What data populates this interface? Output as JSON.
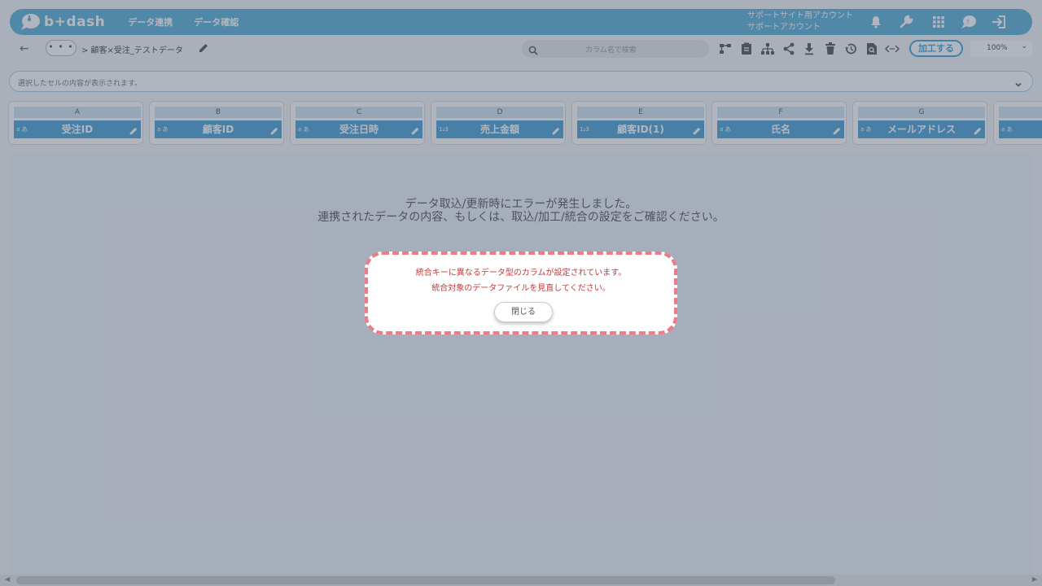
{
  "app": {
    "logo_text": "b+dash",
    "nav": [
      "データ連携",
      "データ確認"
    ],
    "account_line1": "サポートサイト用アカウント",
    "account_line2": "サポートアカウント"
  },
  "toolbar": {
    "more_label": "• • •",
    "breadcrumb": "> 顧客×受注_テストデータ",
    "search_placeholder": "カラム名で検索",
    "process_button": "加工する",
    "zoom": "100%",
    "icons": [
      "flow-icon",
      "clipboard-icon",
      "hierarchy-icon",
      "share-icon",
      "download-icon",
      "trash-icon",
      "history-icon",
      "file-search-icon",
      "code-icon"
    ]
  },
  "cell_bar": {
    "placeholder": "選択したセルの内容が表示されます。"
  },
  "columns": [
    {
      "letter": "A",
      "name": "受注ID",
      "type": "a あ"
    },
    {
      "letter": "B",
      "name": "顧客ID",
      "type": "a あ"
    },
    {
      "letter": "C",
      "name": "受注日時",
      "type": "a あ"
    },
    {
      "letter": "D",
      "name": "売上金額",
      "type": "1₂3"
    },
    {
      "letter": "E",
      "name": "顧客ID(1)",
      "type": "1₂3"
    },
    {
      "letter": "F",
      "name": "氏名",
      "type": "a あ"
    },
    {
      "letter": "G",
      "name": "メールアドレス",
      "type": "a あ"
    },
    {
      "letter": "",
      "name": "",
      "type": "a あ"
    }
  ],
  "main": {
    "error_line1": "データ取込/更新時にエラーが発生しました。",
    "error_line2": "連携されたデータの内容、もしくは、取込/加工/統合の設定をご確認ください。"
  },
  "dialog": {
    "line1": "統合キーに異なるデータ型のカラムが設定されています。",
    "line2": "統合対象のデータファイルを見直してください。",
    "close_label": "閉じる"
  },
  "colors": {
    "header": "#5aaed8",
    "column_header": "#4aa0d6",
    "dialog_border": "#f07a85",
    "dialog_text": "#c23a3a"
  }
}
